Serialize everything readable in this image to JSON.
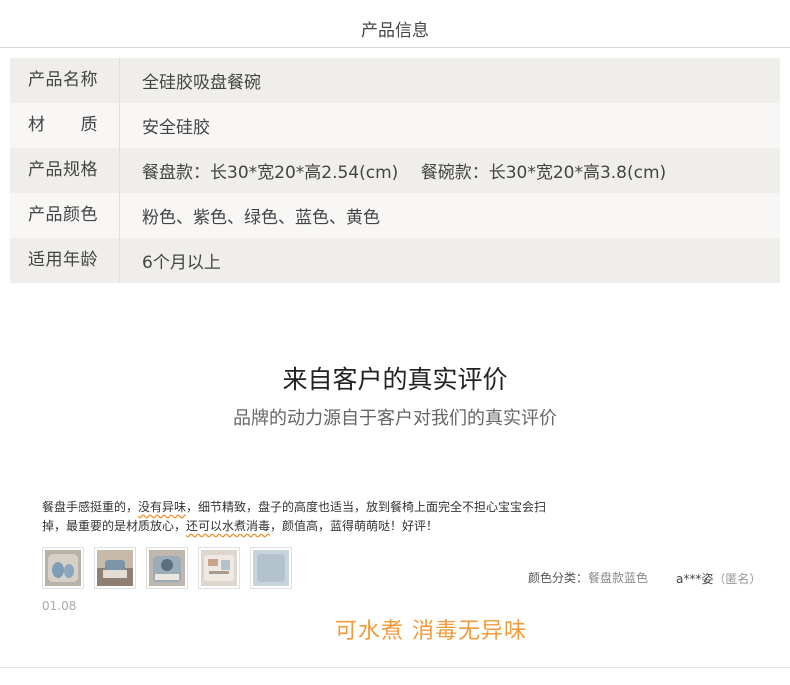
{
  "header": {
    "title": "产品信息"
  },
  "product_info": {
    "rows": [
      {
        "label": "产品名称",
        "value": "全硅胶吸盘餐碗"
      },
      {
        "label": "材　　质",
        "value": "安全硅胶"
      },
      {
        "label": "产品规格",
        "value": "餐盘款：长30*宽20*高2.54(cm)　 餐碗款：长30*宽20*高3.8(cm)"
      },
      {
        "label": "产品颜色",
        "value": "粉色、紫色、绿色、蓝色、黄色"
      },
      {
        "label": "适用年龄",
        "value": "6个月以上"
      }
    ]
  },
  "reviews_section": {
    "title": "来自客户的真实评价",
    "subtitle": "品牌的动力源自于客户对我们的真实评价"
  },
  "review": {
    "text_parts": [
      "餐盘手感挺重的，",
      "没有异味",
      "，细节精致，盘子的高度也适当，放到餐椅上面完全不担心宝宝会扫掉，最重要的是材质放心，",
      "还可以水煮消毒",
      "，颜值高，蓝得萌萌哒！好评！"
    ],
    "date": "01.08",
    "color_key": "颜色分类：",
    "color_value": "餐盘款蓝色",
    "user": "a***姿",
    "anonymous": "（匿名）",
    "photos": [
      {
        "icon": "photo-plate-icon"
      },
      {
        "icon": "photo-plate-icon"
      },
      {
        "icon": "photo-plate-icon"
      },
      {
        "icon": "photo-plate-icon"
      },
      {
        "icon": "photo-plate-icon"
      }
    ]
  },
  "highlight": "可水煮 消毒无异味",
  "colors": {
    "accent": "#f39a3a",
    "row_odd": "#f0eeeb",
    "row_even": "#f8f7f5"
  }
}
